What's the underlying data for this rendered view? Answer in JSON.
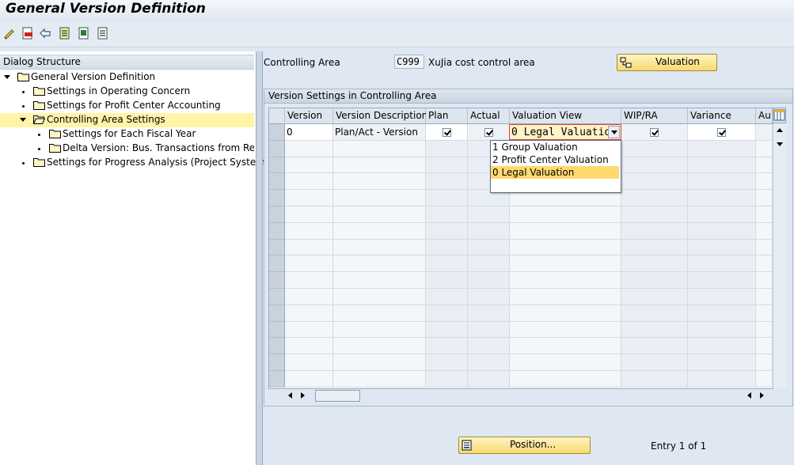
{
  "window": {
    "title": "General Version Definition"
  },
  "toolbar": {
    "buttons": [
      "change-display-icon",
      "delete-icon",
      "undo-icon",
      "select-all-icon",
      "select-block-icon",
      "deselect-all-icon"
    ]
  },
  "dialog_structure": {
    "header": "Dialog Structure",
    "items": [
      {
        "label": "General Version Definition",
        "level": 0,
        "expanded": true
      },
      {
        "label": "Settings in Operating Concern",
        "level": 1
      },
      {
        "label": "Settings for Profit Center Accounting",
        "level": 1
      },
      {
        "label": "Controlling Area Settings",
        "level": 1,
        "expanded": true,
        "selected": true
      },
      {
        "label": "Settings for Each Fiscal Year",
        "level": 2
      },
      {
        "label": "Delta Version: Bus. Transactions from Ref. V",
        "level": 2
      },
      {
        "label": "Settings for Progress Analysis (Project System)",
        "level": 1
      }
    ]
  },
  "controlling_area": {
    "label": "Controlling Area",
    "value": "C999",
    "description": "XuJia cost control area"
  },
  "valuation_button": {
    "label": "Valuation"
  },
  "version_settings": {
    "title": "Version Settings in Controlling Area",
    "columns": [
      "Version",
      "Version Description",
      "Plan",
      "Actual",
      "Valuation View",
      "WIP/RA",
      "Variance",
      "Au"
    ],
    "rows": [
      {
        "version": "0",
        "description": "Plan/Act - Version",
        "plan": true,
        "actual": true,
        "valuation_view": "0 Legal Valuatio",
        "wip_ra": true,
        "variance": true
      }
    ],
    "visible_row_count": 16
  },
  "valuation_dropdown": {
    "options": [
      {
        "label": "1 Group Valuation",
        "selected": false
      },
      {
        "label": "2 Profit Center Valuation",
        "selected": false
      },
      {
        "label": "0 Legal Valuation",
        "selected": true
      }
    ]
  },
  "position_button": {
    "label": "Position..."
  },
  "entry_info": {
    "text": "Entry 1 of 1"
  },
  "colors": {
    "background": "#dfe8f2",
    "button_fill": "#f8d970",
    "selection": "#ffd96d",
    "error_border": "#e04040"
  }
}
